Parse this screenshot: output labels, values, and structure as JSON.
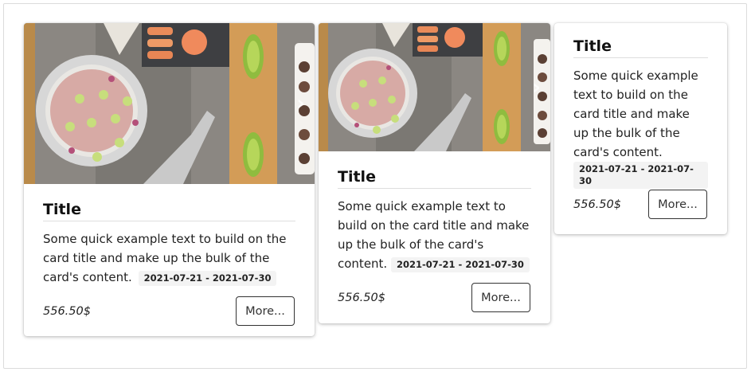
{
  "cards": [
    {
      "title": "Title",
      "text": "Some quick example text to build on the card title and make up the bulk of the card's content.",
      "dates": "2021-07-21 - 2021-07-30",
      "price": "556.50$",
      "button_label": "More...",
      "image_icon": "food-photo",
      "carousel_icon": "chevron-right-icon"
    },
    {
      "title": "Title",
      "text": "Some quick example text to build on the card title and make up the bulk of the card's content.",
      "dates": "2021-07-21 - 2021-07-30",
      "price": "556.50$",
      "button_label": "More...",
      "image_icon": "food-photo",
      "carousel_icon": "chevron-right-icon"
    },
    {
      "title": "Title",
      "text": "Some quick example text to build on the card title and make up the bulk of the card's content.",
      "dates": "2021-07-21 - 2021-07-30",
      "price": "556.50$",
      "button_label": "More..."
    }
  ],
  "colors": {
    "card_border": "#dedede",
    "badge_bg": "#f3f3f3",
    "button_border": "#333333"
  }
}
